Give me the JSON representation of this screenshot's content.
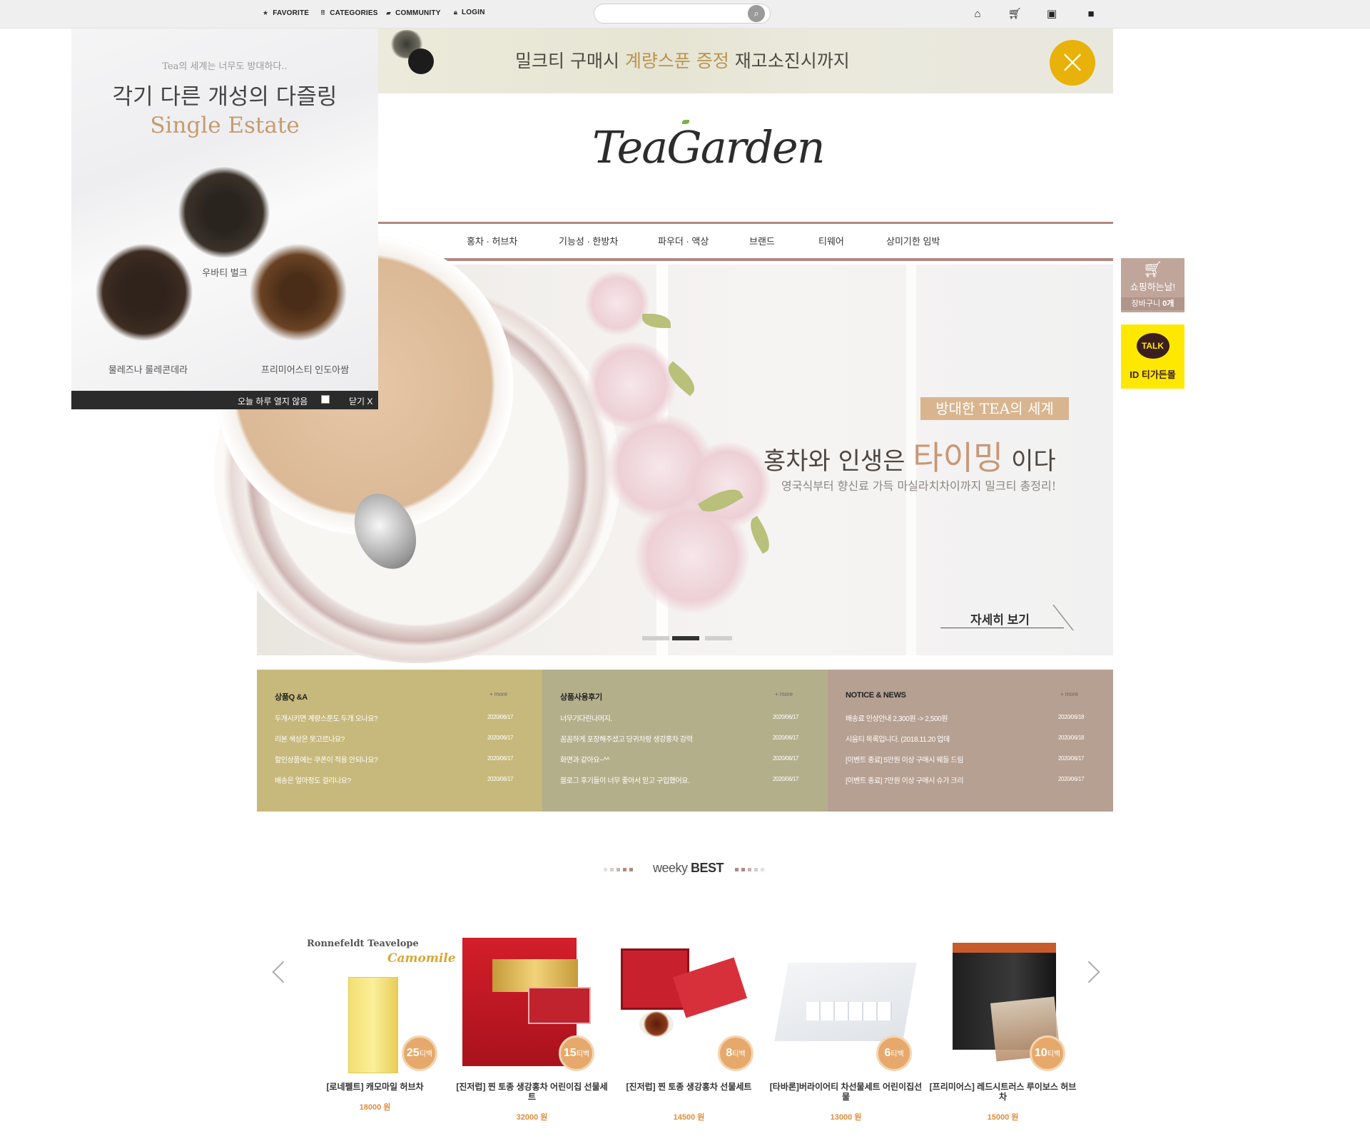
{
  "topbar": {
    "favorite": "FAVORITE",
    "categories": "CATEGORIES",
    "community": "COMMUNITY",
    "login": "LOGIN",
    "search_placeholder": ""
  },
  "promo": {
    "text_before": "밀크티 구매시 ",
    "highlight": "계량스푼 증정",
    "text_after": " 재고소진시까지"
  },
  "logo": "TeaGarden",
  "nav": [
    "홍차 · 허브차",
    "기능성 · 한방차",
    "파우더 · 액상",
    "브랜드",
    "티웨어",
    "상미기한 임박"
  ],
  "sidebar": {
    "cart_title": "쇼핑하는날!",
    "cart_label": "장바구니",
    "cart_count": "0개",
    "talk_label": "TALK",
    "talk_id": "ID 티가든몰"
  },
  "hero": {
    "tag": "방대한 TEA의 세계",
    "title_before": "홍차와 인생은 ",
    "title_highlight": "타이밍",
    "title_after": " 이다",
    "subtitle": "영국식부터 향신료 가득 마실라치차이까지 밀크티 총정리!",
    "more": "자세히 보기",
    "active_slide": 2,
    "slide_count": 3
  },
  "boards": [
    {
      "title": "상품Q &A",
      "more": "+ more",
      "color": "#c7b97c",
      "items": [
        {
          "text": "두개시키면 계량스푼도 두개 오나요?",
          "date": "2020/06/17"
        },
        {
          "text": "리본 색상은 못고르나요?",
          "date": "2020/06/17"
        },
        {
          "text": "할인상품에는 쿠폰이 적용 안되나요?",
          "date": "2020/06/17"
        },
        {
          "text": "배송은 얼마정도 걸리나요?",
          "date": "2020/06/17"
        }
      ]
    },
    {
      "title": "상품사용후기",
      "more": "+ more",
      "color": "#b4af8b",
      "items": [
        {
          "text": "너무기다린나머지.",
          "date": "2020/06/17"
        },
        {
          "text": "꼼꼼하게 포장해주셨고 당귀차랑 생강홍차 강력",
          "date": "2020/06/17"
        },
        {
          "text": "화면과 같아요~^^",
          "date": "2020/06/17"
        },
        {
          "text": "블로그 후기들이 너무 좋아서 믿고 구입했어요.",
          "date": "2020/06/17"
        }
      ]
    },
    {
      "title": "NOTICE & NEWS",
      "more": "+ more",
      "color": "#b6a091",
      "items": [
        {
          "text": "배송료 인상안내 2,300원 -> 2,500원",
          "date": "2020/06/18"
        },
        {
          "text": "시음티 목록입니다. (2018.11.20 업데",
          "date": "2020/06/18"
        },
        {
          "text": "[이벤트 종료] 5만원 이상 구매시 웨들 드림",
          "date": "2020/06/17"
        },
        {
          "text": "[이벤트 종료] 7만원 이상 구매시 슈가 크리",
          "date": "2020/06/17"
        }
      ]
    }
  ],
  "best": {
    "title_light": "weeky ",
    "title_bold": "BEST"
  },
  "products": [
    {
      "name": "[로네펠트] 캐모마일 허브차",
      "price": "18000 원",
      "badge_num": "25",
      "badge_unit": "티백",
      "brand_text": "Ronnefeldt Teavelope",
      "brand_sub": "Camomile"
    },
    {
      "name": "[진저럽] 찐 토종 생강홍차 어린이집 선물세트",
      "price": "32000 원",
      "badge_num": "15",
      "badge_unit": "티백"
    },
    {
      "name": "[진저럽] 찐 토종 생강홍차 선물세트",
      "price": "14500 원",
      "badge_num": "8",
      "badge_unit": "티백"
    },
    {
      "name": "[타바론]버라이어티 차선물세트 어린이집선물",
      "price": "13000 원",
      "badge_num": "6",
      "badge_unit": "티백"
    },
    {
      "name": "[프리미어스] 레드시트러스 루이보스 허브차",
      "price": "15000 원",
      "badge_num": "10",
      "badge_unit": "티백"
    }
  ],
  "popup": {
    "caption": "Tea의 세계는 너무도 방대하다..",
    "title": "각기 다른 개성의 다즐링",
    "subtitle": "Single Estate",
    "tea1": "우바티 벌크",
    "tea2": "물레즈나 룰레콘데라",
    "tea3": "프리미어스티 인도아쌈",
    "no_today": "오늘 하루 열지 않음",
    "close": "닫기 X"
  },
  "colors": {
    "accent_brown": "#b18882",
    "promo_close": "#e8b20a",
    "price": "#e08c3c",
    "badge": "#e6a96b"
  }
}
